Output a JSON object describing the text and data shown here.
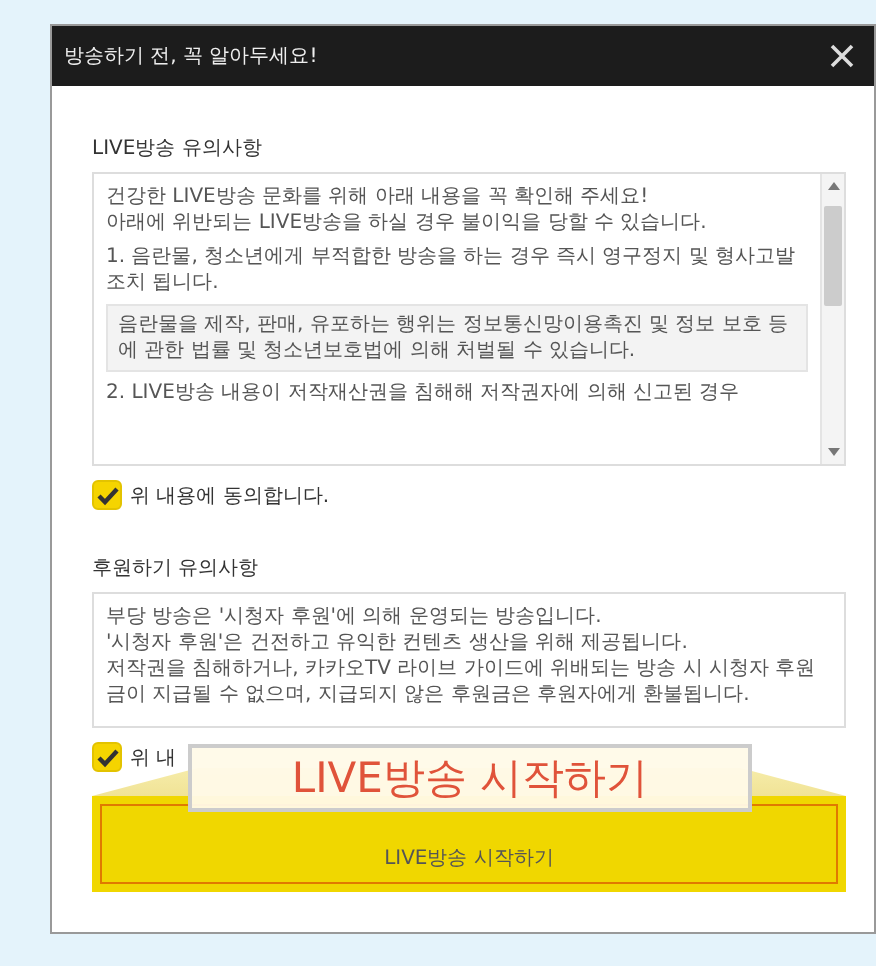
{
  "dialog": {
    "title": "방송하기 전, 꼭 알아두세요!"
  },
  "sections": [
    {
      "title": "LIVE방송 유의사항",
      "paragraphs": [
        {
          "kind": "text",
          "text": "건강한 LIVE방송 문화를 위해 아래 내용을 꼭 확인해 주세요!\n아래에 위반되는 LIVE방송을 하실 경우 불이익을 당할 수 있습니다."
        },
        {
          "kind": "text",
          "text": "1. 음란물, 청소년에게 부적합한 방송을 하는 경우 즉시 영구정지 및 형사고발 조치 됩니다."
        },
        {
          "kind": "note",
          "text": "음란물을 제작, 판매, 유포하는 행위는 정보통신망이용촉진 및 정보 보호 등에 관한 법률 및 청소년보호법에 의해 처벌될 수 있습니다."
        },
        {
          "kind": "text",
          "text": "2. LIVE방송 내용이 저작재산권을 침해해 저작권자에 의해 신고된 경우"
        }
      ],
      "agreement": {
        "label": "위 내용에 동의합니다.",
        "checked": true
      }
    },
    {
      "title": "후원하기 유의사항",
      "paragraphs": [
        {
          "kind": "text",
          "text": "부당 방송은 '시청자 후원'에 의해 운영되는 방송입니다.\n'시청자 후원'은 건전하고 유익한 컨텐츠 생산을 위해 제공됩니다.\n저작권을 침해하거나, 카카오TV 라이브 가이드에 위배되는 방송 시 시청자 후원금이 지급될 수 없으며, 지급되지 않은 후원금은 후원자에게 환불됩니다."
        }
      ],
      "agreement": {
        "label": "위 내",
        "checked": true
      }
    }
  ],
  "start_button": {
    "label": "LIVE방송 시작하기"
  },
  "callout": {
    "label": "LIVE방송 시작하기"
  }
}
